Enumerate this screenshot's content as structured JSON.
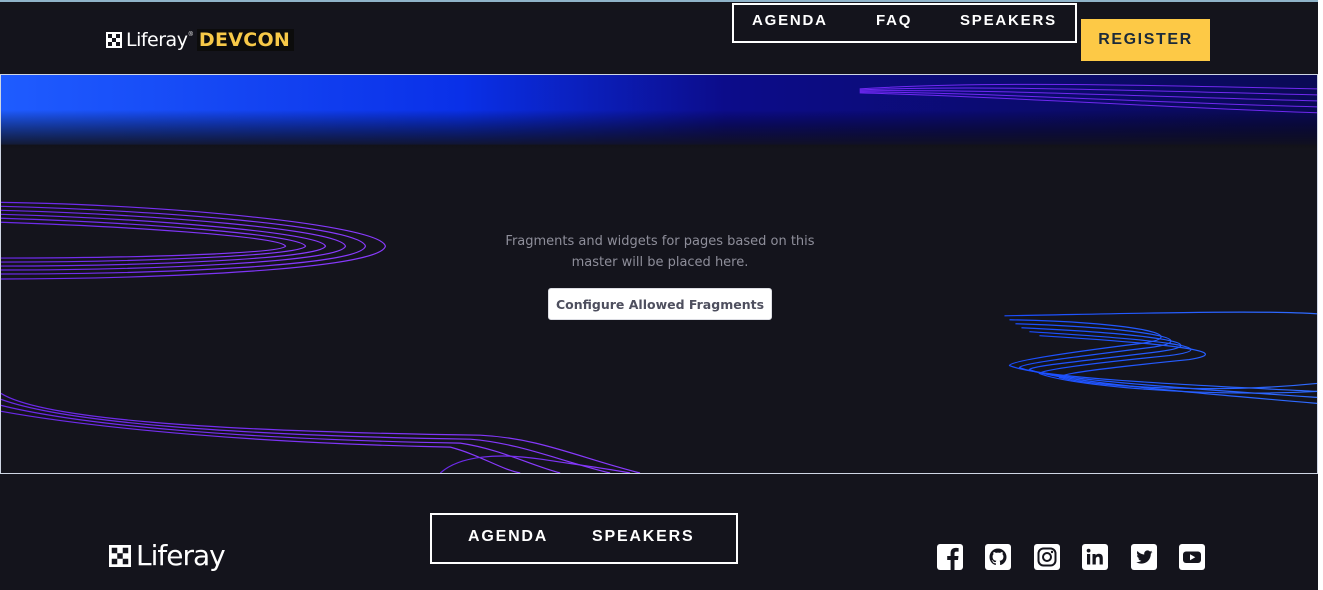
{
  "header": {
    "logo": {
      "wordmark": "Liferay",
      "registered": "®",
      "event": "DEVCON"
    },
    "nav": [
      {
        "label": "AGENDA"
      },
      {
        "label": "FAQ"
      },
      {
        "label": "SPEAKERS"
      }
    ],
    "register_label": "REGISTER"
  },
  "hero": {
    "message_line1": "Fragments and widgets for pages based on this",
    "message_line2": "master will be placed here.",
    "configure_label": "Configure Allowed Fragments"
  },
  "footer": {
    "logo": {
      "wordmark": "Liferay"
    },
    "nav": [
      {
        "label": "AGENDA"
      },
      {
        "label": "SPEAKERS"
      }
    ],
    "social": [
      {
        "icon": "facebook-icon"
      },
      {
        "icon": "github-icon"
      },
      {
        "icon": "instagram-icon"
      },
      {
        "icon": "linkedin-icon"
      },
      {
        "icon": "twitter-icon"
      },
      {
        "icon": "youtube-icon"
      }
    ]
  },
  "colors": {
    "background": "#14141c",
    "accent_yellow": "#fdc946",
    "wave_purple": "#7a2cff",
    "wave_blue": "#1f5cff"
  }
}
